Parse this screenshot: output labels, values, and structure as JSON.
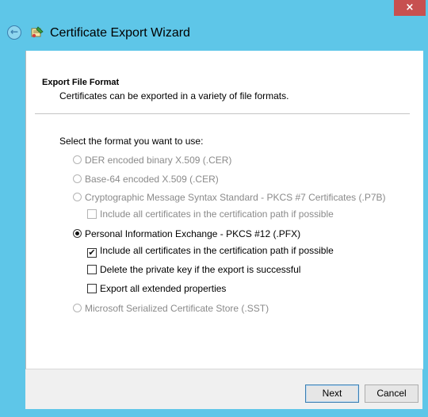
{
  "window": {
    "title": "Certificate Export Wizard",
    "close_glyph": "×",
    "back_glyph": "←"
  },
  "header": {
    "section_title": "Export File Format",
    "section_subtitle": "Certificates can be exported in a variety of file formats."
  },
  "form": {
    "prompt": "Select the format you want to use:",
    "options": [
      {
        "label": "DER encoded binary X.509 (.CER)",
        "selected": false,
        "enabled": false
      },
      {
        "label": "Base-64 encoded X.509 (.CER)",
        "selected": false,
        "enabled": false
      },
      {
        "label": "Cryptographic Message Syntax Standard - PKCS #7 Certificates (.P7B)",
        "selected": false,
        "enabled": false
      },
      {
        "label": "Personal Information Exchange - PKCS #12 (.PFX)",
        "selected": true,
        "enabled": true
      },
      {
        "label": "Microsoft Serialized Certificate Store (.SST)",
        "selected": false,
        "enabled": false
      }
    ],
    "p7b_include_all": {
      "label": "Include all certificates in the certification path if possible",
      "checked": false,
      "enabled": false
    },
    "pfx_options": [
      {
        "label": "Include all certificates in the certification path if possible",
        "checked": true,
        "enabled": true
      },
      {
        "label": "Delete the private key if the export is successful",
        "checked": false,
        "enabled": true
      },
      {
        "label": "Export all extended properties",
        "checked": false,
        "enabled": true
      }
    ],
    "check_glyph": "✔"
  },
  "footer": {
    "next_label": "Next",
    "cancel_label": "Cancel"
  },
  "colors": {
    "frame": "#5ec6e8",
    "close": "#c75050",
    "disabled_text": "#8a8a8a"
  }
}
